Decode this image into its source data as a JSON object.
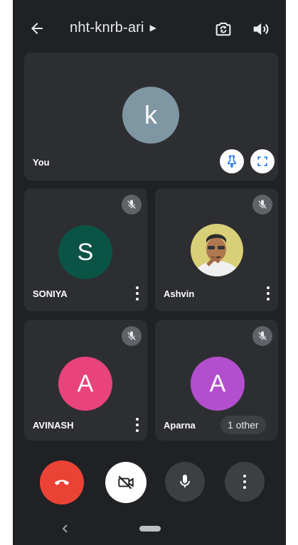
{
  "header": {
    "meeting_code": "nht-knrb-ari",
    "icons": {
      "back": "arrow-back-icon",
      "meeting_details": "caret-right-icon",
      "switch_camera": "switch-camera-icon",
      "audio_output": "speaker-icon"
    }
  },
  "self_tile": {
    "initial": "k",
    "name": "You",
    "avatar_color": "#7f96a3",
    "buttons": {
      "pin": "pin-icon",
      "fullscreen": "fullscreen-icon"
    }
  },
  "participants": [
    {
      "initial": "S",
      "name": "SONIYA",
      "avatar_color": "#0b5345",
      "muted": true,
      "icon": "mic-off-icon"
    },
    {
      "initial": "",
      "name": "Ashvin",
      "avatar": "photo",
      "muted": true,
      "icon": "mic-off-icon"
    },
    {
      "initial": "A",
      "name": "AVINASH",
      "avatar_color": "#e8437a",
      "muted": true,
      "icon": "mic-off-icon"
    },
    {
      "initial": "A",
      "name": "Aparna",
      "avatar_color": "#b34fcf",
      "muted": true,
      "icon": "mic-off-icon"
    }
  ],
  "overflow_chip": "1 other",
  "controls": {
    "end_call": {
      "icon": "end-call-icon",
      "color": "#ea4335"
    },
    "camera": {
      "icon": "camera-off-icon",
      "color": "#ffffff"
    },
    "microphone": {
      "icon": "microphone-icon",
      "color": "#3c4043"
    },
    "more": {
      "icon": "more-vert-icon",
      "color": "#3c4043"
    }
  },
  "system_nav": {
    "back": "nav-back-icon",
    "home": "home-pill-icon"
  }
}
